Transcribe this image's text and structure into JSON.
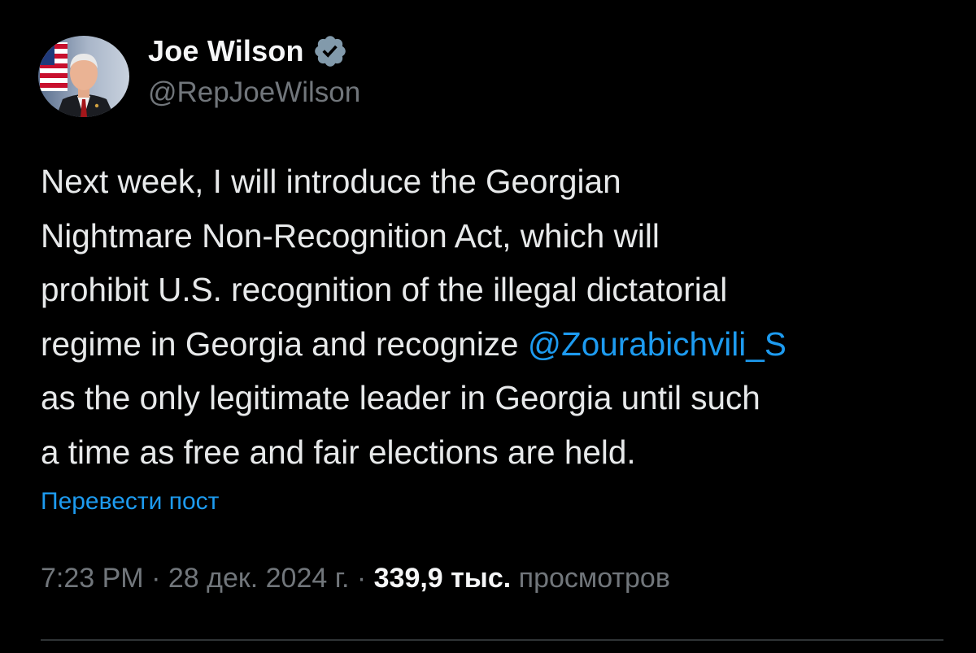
{
  "author": {
    "display_name": "Joe Wilson",
    "handle": "@RepJoeWilson",
    "verified_icon": "verified-badge-icon",
    "avatar_icon": "avatar-icon"
  },
  "tweet": {
    "lines": [
      {
        "text": "Next week, I will introduce the Georgian"
      },
      {
        "text": "Nightmare Non-Recognition Act, which will"
      },
      {
        "text": "prohibit U.S. recognition of the illegal dictatorial"
      },
      {
        "text_before": "regime in Georgia and recognize ",
        "mention": "@Zourabichvili_S"
      },
      {
        "text": "as the only legitimate leader in Georgia until such"
      },
      {
        "text": "a time as free and fair elections are held."
      }
    ]
  },
  "translate_label": "Перевести пост",
  "meta": {
    "time": "7:23 PM",
    "separator": " · ",
    "date": "28 дек. 2024 г.",
    "views_count": "339,9 тыс.",
    "views_label": "просмотров"
  },
  "colors": {
    "background": "#000000",
    "text": "#e7e9ea",
    "secondary": "#71767b",
    "link": "#1d9bf0",
    "divider": "#2f3336"
  }
}
